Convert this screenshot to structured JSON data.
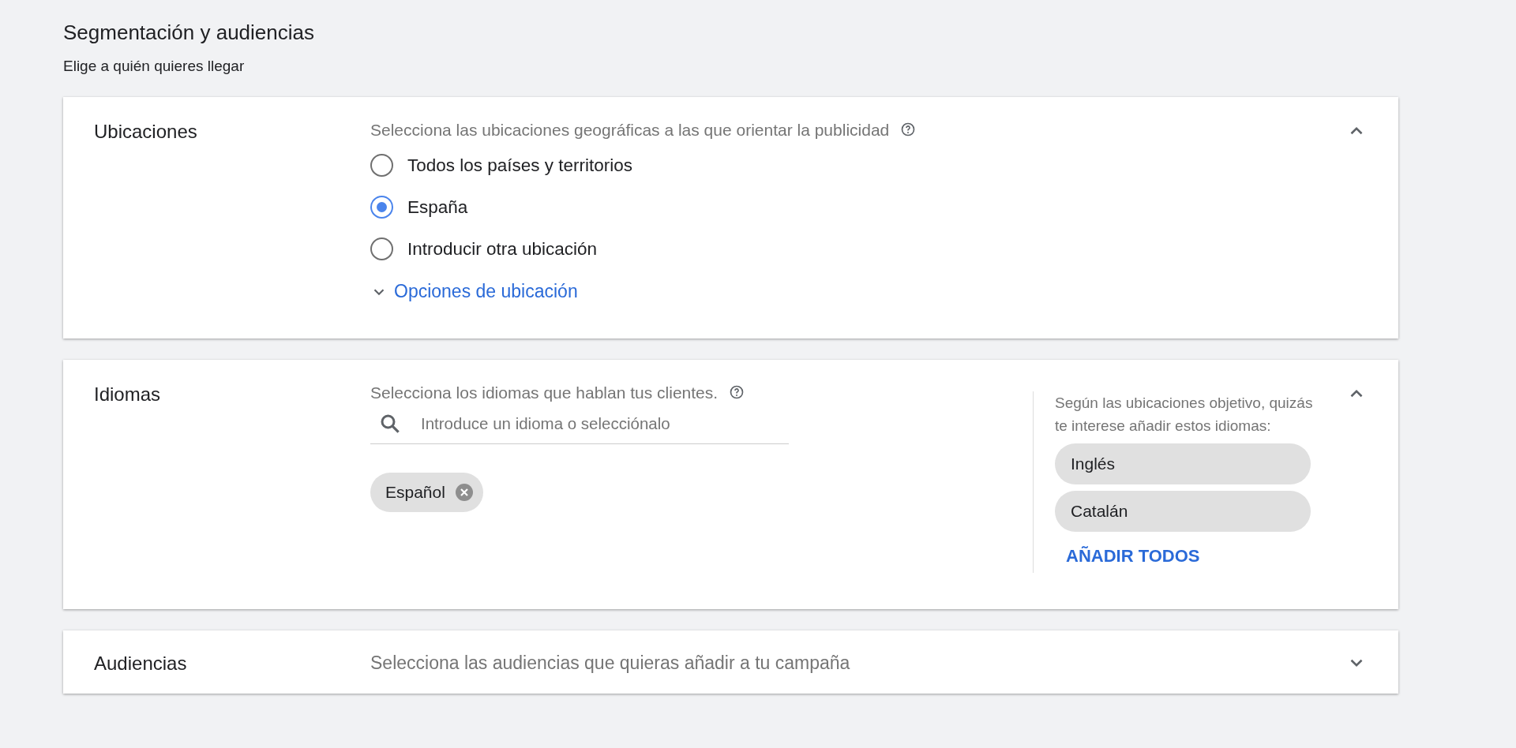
{
  "header": {
    "title": "Segmentación y audiencias",
    "subtitle": "Elige a quién quieres llegar"
  },
  "sections": [
    {
      "kind": "locations",
      "title": "Ubicaciones",
      "expanded": true,
      "prompt": "Selecciona las ubicaciones geográficas a las que orientar la publicidad",
      "help": true,
      "options": [
        {
          "label": "Todos los países y territorios",
          "selected": false
        },
        {
          "label": "España",
          "selected": true
        },
        {
          "label": "Introducir otra ubicación",
          "selected": false
        }
      ],
      "more_link": {
        "label": "Opciones de ubicación",
        "expanded": false
      }
    },
    {
      "kind": "languages",
      "title": "Idiomas",
      "expanded": true,
      "prompt": "Selecciona los idiomas que hablan tus clientes.",
      "help": true,
      "search": {
        "placeholder": "Introduce un idioma o selecciónalo"
      },
      "chips": [
        "Español"
      ],
      "suggestions": {
        "text": "Según las ubicaciones objetivo, quizás te interese añadir estos idiomas:",
        "items": [
          "Inglés",
          "Catalán"
        ],
        "add_all": "AÑADIR TODOS"
      }
    },
    {
      "kind": "audiences",
      "title": "Audiencias",
      "expanded": false,
      "prompt": "Selecciona las audiencias que quieras añadir a tu campaña",
      "help": false
    }
  ]
}
